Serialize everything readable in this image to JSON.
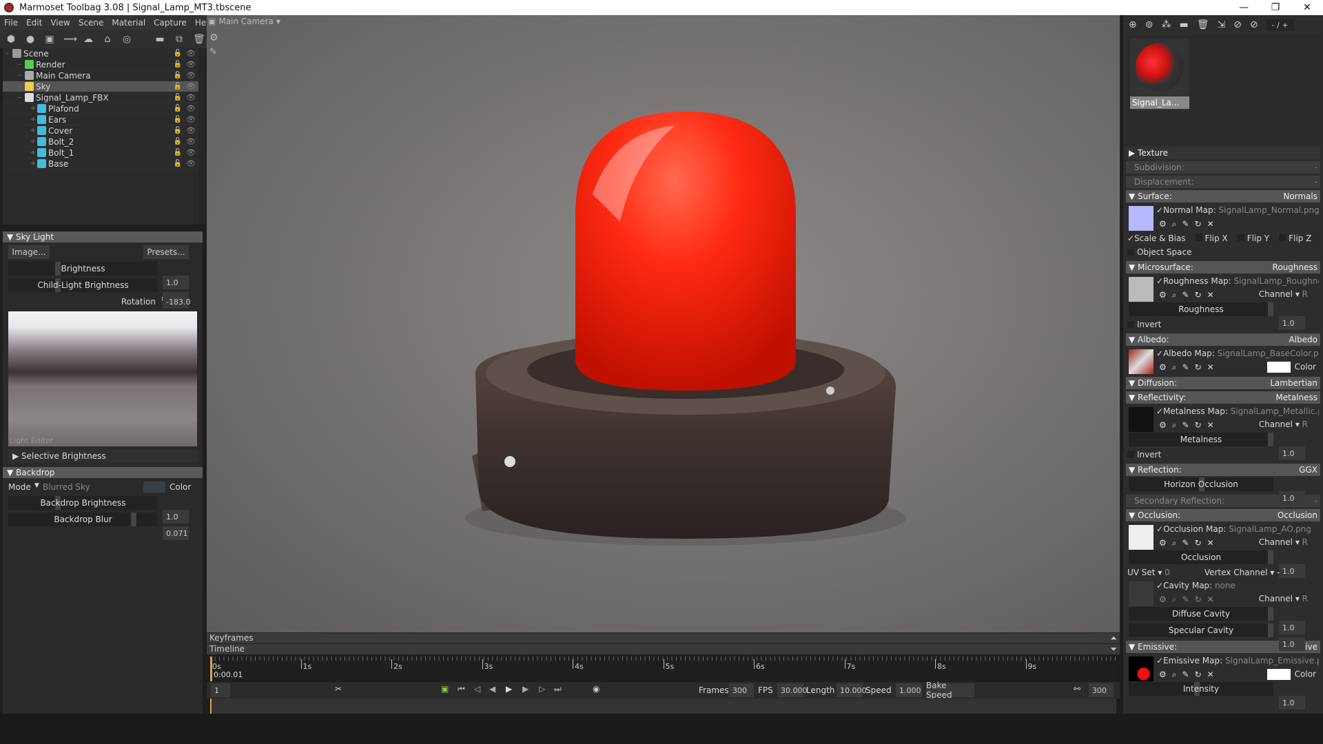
{
  "window": {
    "title": "Marmoset Toolbag 3.08  |  Signal_Lamp_MT3.tbscene",
    "minimize": "—",
    "restore": "❐",
    "close": "✕"
  },
  "menu": [
    "File",
    "Edit",
    "View",
    "Scene",
    "Material",
    "Capture",
    "Help"
  ],
  "scene_tree": [
    {
      "label": "Scene",
      "indent": 0,
      "color": "#999"
    },
    {
      "label": "Render",
      "indent": 1,
      "color": "#5c5"
    },
    {
      "label": "Main Camera",
      "indent": 1,
      "color": "#aaa"
    },
    {
      "label": "Sky",
      "indent": 1,
      "color": "#ec5",
      "selected": true
    },
    {
      "label": "Signal_Lamp_FBX",
      "indent": 1,
      "color": "#ddd"
    },
    {
      "label": "Plafond",
      "indent": 2,
      "color": "#4bd"
    },
    {
      "label": "Ears",
      "indent": 2,
      "color": "#4bd"
    },
    {
      "label": "Cover",
      "indent": 2,
      "color": "#4bd"
    },
    {
      "label": "Bolt_2",
      "indent": 2,
      "color": "#4bd"
    },
    {
      "label": "Bolt_1",
      "indent": 2,
      "color": "#4bd"
    },
    {
      "label": "Base",
      "indent": 2,
      "color": "#4bd"
    }
  ],
  "sky_light": {
    "title": "Sky Light",
    "image_btn": "Image...",
    "presets_btn": "Presets...",
    "brightness_label": "Brightness",
    "brightness": "1.0",
    "child_label": "Child-Light Brightness",
    "child": "1.0",
    "rotation_label": "Rotation",
    "rotation": "-183.0",
    "light_editor": "Light Editor",
    "selective": "Selective Brightness"
  },
  "backdrop": {
    "title": "Backdrop",
    "mode_label": "Mode",
    "mode": "Blurred Sky",
    "color_label": "Color",
    "brightness_label": "Backdrop Brightness",
    "brightness": "1.0",
    "blur_label": "Backdrop Blur",
    "blur": "0.071"
  },
  "viewport": {
    "camera": "Main Camera"
  },
  "timeline": {
    "keyframes": "Keyframes",
    "timeline": "Timeline",
    "ticks": [
      "0s",
      "1s",
      "2s",
      "3s",
      "4s",
      "5s",
      "6s",
      "7s",
      "8s",
      "9s"
    ],
    "current_time": "0:00.01",
    "frame": "1",
    "frames_label": "Frames",
    "frames": "300",
    "fps_label": "FPS",
    "fps": "30.000",
    "length_label": "Length",
    "length": "10.000",
    "speed_label": "Speed",
    "speed": "1.000",
    "bake_speed": "Bake Speed",
    "end_frame": "300"
  },
  "materials": {
    "page": "- / +",
    "selected_name": "Signal_La..."
  },
  "material": {
    "texture": "Texture",
    "subdivision": "Subdivision:",
    "subdivision_val": "-",
    "displacement": "Displacement:",
    "displacement_val": "-",
    "surface": "Surface:",
    "surface_val": "Normals",
    "normal_map_label": "Normal Map:",
    "normal_map": "SignalLamp_Normal.png",
    "scale_bias": "Scale & Bias",
    "flip_x": "Flip X",
    "flip_y": "Flip Y",
    "flip_z": "Flip Z",
    "object_space": "Object Space",
    "microsurface": "Microsurface:",
    "microsurface_val": "Roughness",
    "roughness_map_label": "Roughness Map:",
    "roughness_map": "SignalLamp_Roughness.png",
    "channel_label": "Channel",
    "channel": "R",
    "roughness_label": "Roughness",
    "roughness": "1.0",
    "invert": "Invert",
    "albedo": "Albedo:",
    "albedo_val": "Albedo",
    "albedo_map_label": "Albedo Map:",
    "albedo_map": "SignalLamp_BaseColor.png",
    "color_label": "Color",
    "diffusion": "Diffusion:",
    "diffusion_val": "Lambertian",
    "reflectivity": "Reflectivity:",
    "reflectivity_val": "Metalness",
    "metal_map_label": "Metalness Map:",
    "metal_map": "SignalLamp_Metallic.png",
    "metalness_label": "Metalness",
    "metalness": "1.0",
    "reflection": "Reflection:",
    "reflection_val": "GGX",
    "horizon_label": "Horizon Occlusion",
    "horizon": "1.0",
    "secondary": "Secondary Reflection:",
    "secondary_val": "-",
    "occlusion": "Occlusion:",
    "occlusion_val": "Occlusion",
    "occ_map_label": "Occlusion Map:",
    "occ_map": "SignalLamp_AO.png",
    "occlusion_label": "Occlusion",
    "occlusion_num": "1.0",
    "uv_set_label": "UV Set",
    "uv_set": "0",
    "vertex_channel_label": "Vertex Channel",
    "vertex_channel": "-",
    "cavity_map_label": "Cavity Map:",
    "cavity_map": "none",
    "diffuse_cavity_label": "Diffuse Cavity",
    "diffuse_cavity": "1.0",
    "specular_cavity_label": "Specular Cavity",
    "specular_cavity": "1.0",
    "emissive": "Emissive:",
    "emissive_val": "Emissive",
    "emissive_map_label": "Emissive Map:",
    "emissive_map": "SignalLamp_Emissive.png",
    "intensity_label": "Intensity",
    "intensity": "1.0"
  }
}
